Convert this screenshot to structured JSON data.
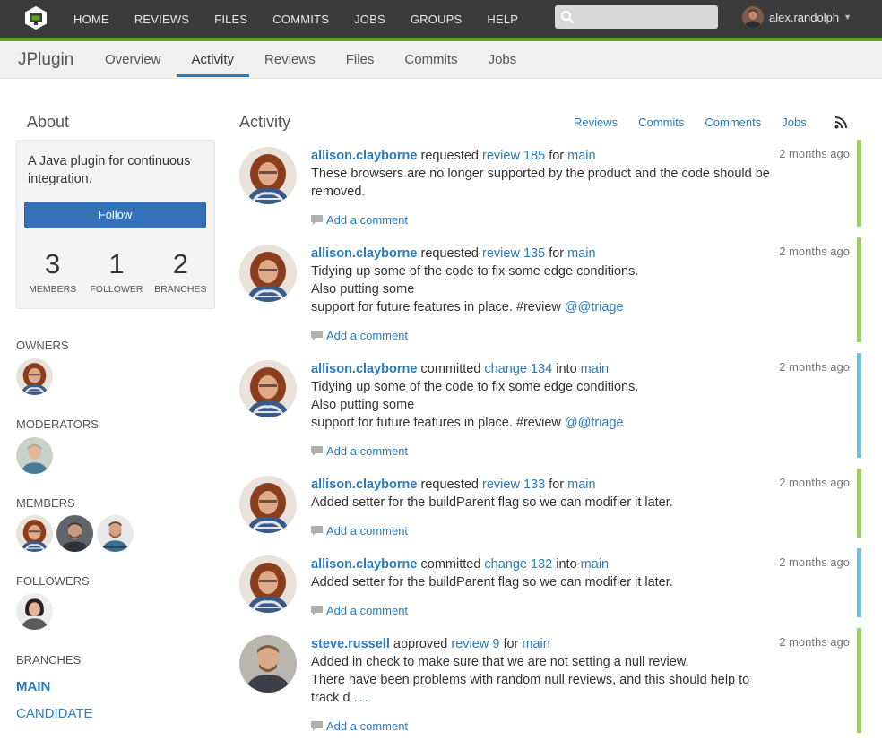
{
  "topnav": {
    "items": [
      "HOME",
      "REVIEWS",
      "FILES",
      "COMMITS",
      "JOBS",
      "GROUPS",
      "HELP"
    ],
    "search_placeholder": "",
    "username": "alex.randolph",
    "caret": "▼"
  },
  "project": {
    "name": "JPlugin",
    "tabs": [
      "Overview",
      "Activity",
      "Reviews",
      "Files",
      "Commits",
      "Jobs"
    ],
    "active_tab": "Activity"
  },
  "about": {
    "title": "About",
    "description": "A Java plugin for continuous integration.",
    "follow_label": "Follow",
    "stats": [
      {
        "value": "3",
        "label": "MEMBERS"
      },
      {
        "value": "1",
        "label": "FOLLOWER"
      },
      {
        "value": "2",
        "label": "BRANCHES"
      }
    ]
  },
  "sidebar": {
    "owners_title": "OWNERS",
    "moderators_title": "MODERATORS",
    "members_title": "MEMBERS",
    "followers_title": "FOLLOWERS",
    "branches_title": "BRANCHES",
    "branches": [
      "MAIN",
      "CANDIDATE"
    ]
  },
  "activity": {
    "title": "Activity",
    "filters": [
      "Reviews",
      "Commits",
      "Comments",
      "Jobs"
    ],
    "add_comment": "Add a comment",
    "items": [
      {
        "user": "allison.clayborne",
        "verb": "requested",
        "target": "review 185",
        "prep": "for",
        "branch": "main",
        "lines": [
          "These browsers are no longer supported by the product and the code should be removed."
        ],
        "tag": "",
        "ellipsis": "",
        "time": "2 months ago",
        "bar_color": "#a2cc6a"
      },
      {
        "user": "allison.clayborne",
        "verb": "requested",
        "target": "review 135",
        "prep": "for",
        "branch": "main",
        "lines": [
          "Tidying up some of the code to fix some edge conditions.",
          "Also putting some",
          "support for future features in place. #review "
        ],
        "tag": "@@triage",
        "ellipsis": "",
        "time": "2 months ago",
        "bar_color": "#a2cc6a"
      },
      {
        "user": "allison.clayborne",
        "verb": "committed",
        "target": "change 134",
        "prep": "into",
        "branch": "main",
        "lines": [
          "Tidying up some of the code to fix some edge conditions.",
          "Also putting some",
          "support for future features in place. #review "
        ],
        "tag": "@@triage",
        "ellipsis": "",
        "time": "2 months ago",
        "bar_color": "#7bbfd6"
      },
      {
        "user": "allison.clayborne",
        "verb": "requested",
        "target": "review 133",
        "prep": "for",
        "branch": "main",
        "lines": [
          "Added setter for the buildParent flag so we can modifier it later."
        ],
        "tag": "",
        "ellipsis": "",
        "time": "2 months ago",
        "bar_color": "#a2cc6a"
      },
      {
        "user": "allison.clayborne",
        "verb": "committed",
        "target": "change 132",
        "prep": "into",
        "branch": "main",
        "lines": [
          "Added setter for the buildParent flag so we can modifier it later."
        ],
        "tag": "",
        "ellipsis": "",
        "time": "2 months ago",
        "bar_color": "#7bbfd6"
      },
      {
        "user": "steve.russell",
        "verb": "approved",
        "target": "review 9",
        "prep": "for",
        "branch": "main",
        "lines": [
          "Added in check to make sure that we are not setting a null review.",
          "There have been problems with random null reviews, and this should help to track d"
        ],
        "tag": "",
        "ellipsis": "...",
        "time": "2 months ago",
        "bar_color": "#a2cc6a"
      }
    ]
  }
}
